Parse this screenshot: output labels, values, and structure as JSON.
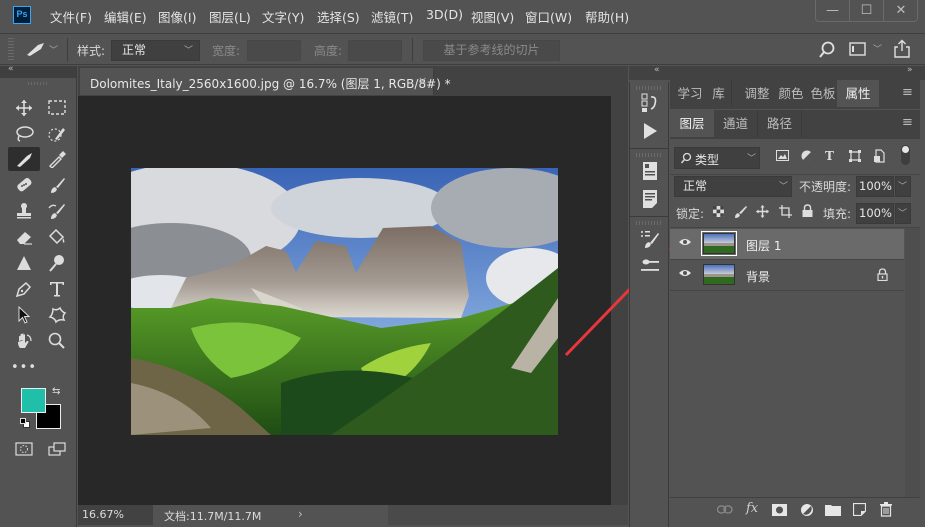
{
  "app": {
    "logo": "Ps",
    "menu": [
      "文件(F)",
      "编辑(E)",
      "图像(I)",
      "图层(L)",
      "文字(Y)",
      "选择(S)",
      "滤镜(T)",
      "3D(D)",
      "视图(V)",
      "窗口(W)",
      "帮助(H)"
    ],
    "window_controls": {
      "minimize": "—",
      "maximize": "☐",
      "close": "✕"
    }
  },
  "options_bar": {
    "tool_icon": "slice-tool-icon",
    "style_label": "样式:",
    "style_value": "正常",
    "width_label": "宽度:",
    "width_value": "",
    "height_label": "高度:",
    "height_value": "",
    "slices_from_guides": "基于参考线的切片"
  },
  "toolbar": {
    "tools": [
      "move-tool",
      "marquee-tool",
      "lasso-tool",
      "quick-selection-tool",
      "slice-tool",
      "eyedropper-tool",
      "healing-brush-tool",
      "brush-tool",
      "clone-stamp-tool",
      "history-brush-tool",
      "eraser-tool",
      "paint-bucket-tool",
      "sharpen-tool",
      "dodge-tool",
      "pen-tool",
      "type-tool",
      "path-selection-tool",
      "custom-shape-tool",
      "hand-tool",
      "zoom-tool"
    ],
    "active_tool": "slice-tool",
    "more": "•••",
    "foreground_color": "#1fbfa9",
    "background_color": "#000000"
  },
  "document": {
    "tab_title": "Dolomites_Italy_2560x1600.jpg @ 16.7% (图层 1, RGB/8#) *",
    "close": "×",
    "zoom": "16.67%",
    "doc_info": "文档:11.7M/11.7M",
    "status_arrow": "›"
  },
  "properties_panel": {
    "tabs": [
      "学习",
      "库",
      "调整",
      "颜色",
      "色板",
      "属性"
    ],
    "active_tab": "属性"
  },
  "layers_panel": {
    "tabs": [
      "图层",
      "通道",
      "路径"
    ],
    "active_tab": "图层",
    "filter_label": "类型",
    "blend_mode": "正常",
    "opacity_label": "不透明度:",
    "opacity_value": "100%",
    "lock_label": "锁定:",
    "fill_label": "填充:",
    "fill_value": "100%",
    "layers": [
      {
        "name": "图层 1",
        "visible": true,
        "selected": true,
        "locked": false
      },
      {
        "name": "背景",
        "visible": true,
        "selected": false,
        "locked": true
      }
    ],
    "bottom_actions": [
      "link-layers",
      "layer-style",
      "add-mask",
      "adjustment-layer",
      "new-group",
      "new-layer",
      "delete-layer"
    ],
    "fx_label": "fx"
  },
  "annotation": {
    "arrow_color": "#e8373a"
  }
}
